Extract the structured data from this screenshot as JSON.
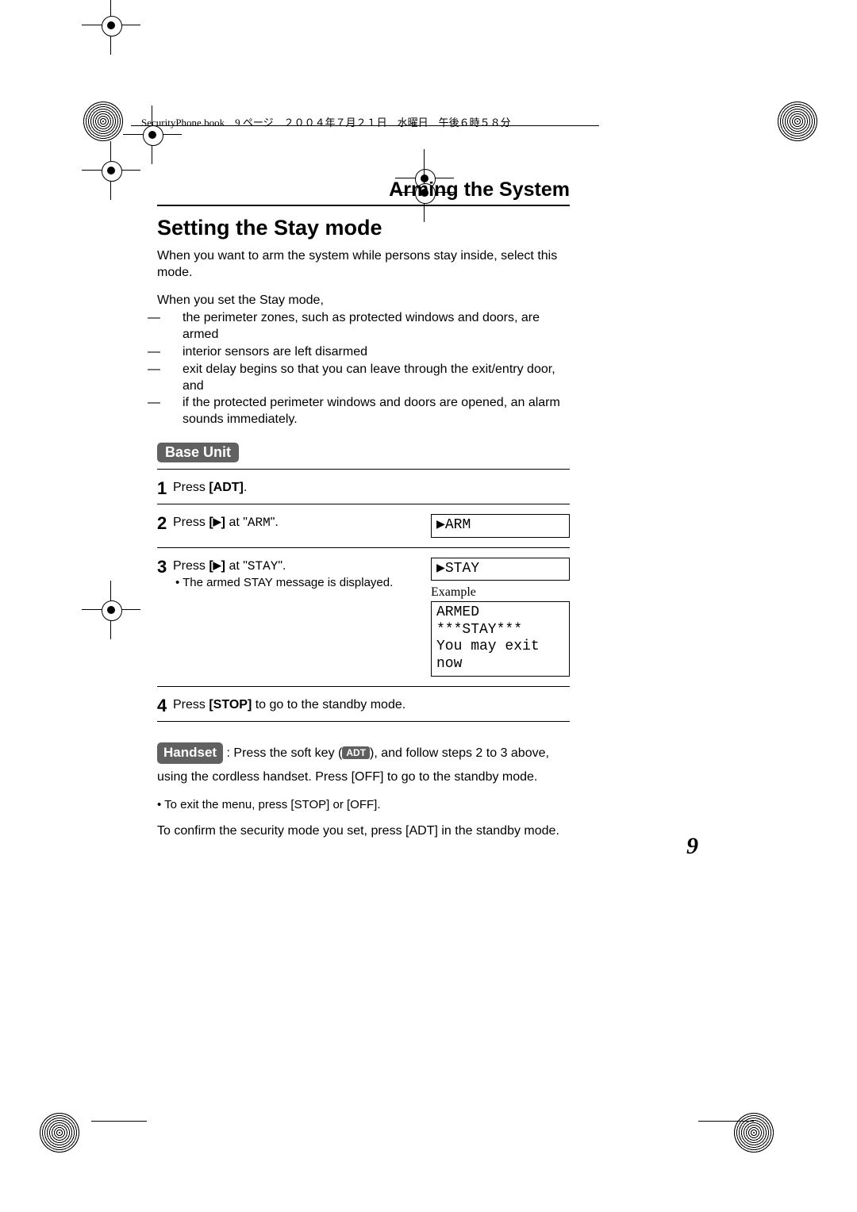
{
  "header_note": "SecurityPhone.book　9 ページ　２００４年７月２１日　水曜日　午後６時５８分",
  "chapter_title": "Arming the System",
  "section_title": "Setting the Stay mode",
  "intro_text": "When you want to arm the system while persons stay inside, select this mode.",
  "when_set_lead": "When you set the Stay mode,",
  "bullets": [
    "the perimeter zones, such as protected windows and doors, are armed",
    "interior sensors are left disarmed",
    "exit delay begins so that you can leave through the exit/entry door, and",
    "if the protected perimeter windows and doors are opened, an alarm sounds immediately."
  ],
  "base_unit_label": "Base Unit",
  "steps": {
    "s1": {
      "num": "1",
      "text_before": "Press ",
      "key": "[ADT]",
      "text_after": "."
    },
    "s2": {
      "num": "2",
      "text_before": "Press ",
      "key_front": "[",
      "tri": "▶",
      "key_back": "]",
      "at": " at \"",
      "mono": "ARM",
      "after": "\".",
      "lcd": "▶ARM"
    },
    "s3": {
      "num": "3",
      "text_before": "Press ",
      "key_front": "[",
      "tri": "▶",
      "key_back": "]",
      "at": " at \"",
      "mono": "STAY",
      "after": "\".",
      "sub": "• The armed STAY message is displayed.",
      "lcd": "▶STAY",
      "example_label": "Example",
      "example_l1": "ARMED ***STAY***",
      "example_l2": "You may exit now"
    },
    "s4": {
      "num": "4",
      "text_before": "Press ",
      "key": "[STOP]",
      "text_after": " to go to the standby mode."
    }
  },
  "handset_label": "Handset",
  "handset_text_before": " : Press the soft key (",
  "handset_softkey": "ADT",
  "handset_text_mid": "), and follow steps 2 to 3 above, using the cordless handset. Press ",
  "handset_key": "[OFF]",
  "handset_text_after": " to go to the standby mode.",
  "exit_note_before": "• To exit the menu, press ",
  "exit_note_key1": "[STOP]",
  "exit_note_or": " or ",
  "exit_note_key2": "[OFF]",
  "exit_note_after": ".",
  "confirm_bold": "To confirm the security mode you set,",
  "confirm_rest_before": " press ",
  "confirm_key": "[ADT]",
  "confirm_rest_after": " in the standby mode.",
  "page_number": "9"
}
